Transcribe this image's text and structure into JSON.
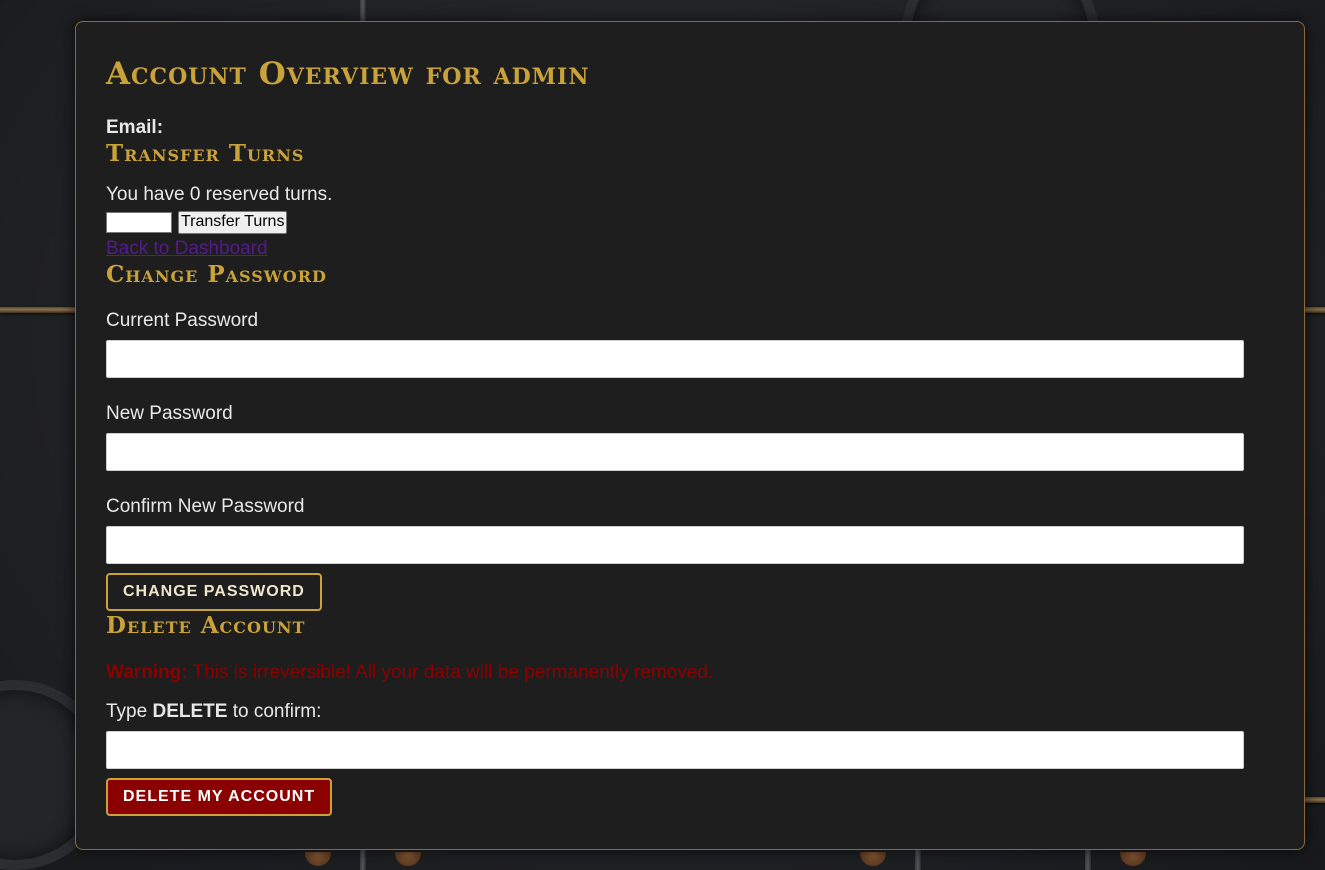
{
  "page": {
    "title": "Account Overview for admin",
    "email_label": "Email:",
    "email_value": ""
  },
  "transfer": {
    "heading": "Transfer Turns",
    "reserved_text": "You have 0 reserved turns.",
    "input_value": "",
    "button_label": "Transfer Turns",
    "back_link": "Back to Dashboard"
  },
  "password": {
    "heading": "Change Password",
    "current_label": "Current Password",
    "new_label": "New Password",
    "confirm_label": "Confirm New Password",
    "button_label": "Change Password"
  },
  "delete": {
    "heading": "Delete Account",
    "warning_prefix": "Warning:",
    "warning_text": " This is irreversible! All your data will be permanently removed.",
    "confirm_prefix": "Type ",
    "confirm_keyword": "DELETE",
    "confirm_suffix": " to confirm:",
    "button_label": "Delete My Account"
  },
  "colors": {
    "accent_gold": "#c9a23a",
    "panel_bg": "#1e1e1e",
    "danger": "#8b0000",
    "visited_link": "#551a8b"
  }
}
